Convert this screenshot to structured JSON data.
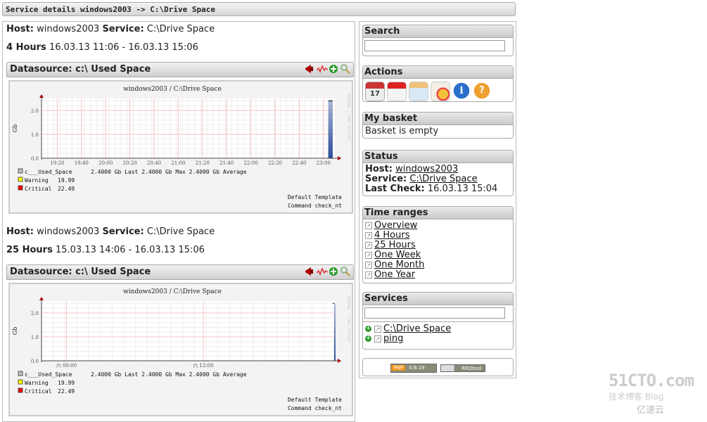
{
  "title": "Service details windows2003 -> C:\\Drive Space",
  "sections": [
    {
      "host_label": "Host:",
      "host": "windows2003",
      "service_label": "Service:",
      "service": "C:\\Drive Space",
      "range_label": "4 Hours",
      "range_value": "16.03.13 11:06 - 16.03.13 15:06",
      "datasource": "Datasource: c:\\ Used Space",
      "icons": [
        "megaphone-icon",
        "graph-line-icon",
        "add-basket-icon",
        "zoom-icon"
      ]
    },
    {
      "host_label": "Host:",
      "host": "windows2003",
      "service_label": "Service:",
      "service": "C:\\Drive Space",
      "range_label": "25 Hours",
      "range_value": "15.03.13 14:06 - 16.03.13 15:06",
      "datasource": "Datasource: c:\\ Used Space",
      "icons": [
        "megaphone-icon",
        "graph-line-icon",
        "add-basket-icon",
        "zoom-icon"
      ]
    }
  ],
  "chart_data": [
    {
      "type": "area",
      "title": "windows2003 / C:\\Drive Space",
      "ylabel": "Gb",
      "xlabel": "",
      "ylim": [
        0,
        2.5
      ],
      "yticks": [
        "0.0",
        "1.0",
        "2.0"
      ],
      "x_ticks": [
        "19:20",
        "19:40",
        "20:00",
        "20:20",
        "20:40",
        "21:00",
        "21:20",
        "21:40",
        "22:00",
        "22:20",
        "22:40",
        "23:00"
      ],
      "series": [
        {
          "name": "c___Used_Space",
          "data_start_fraction": 0.975,
          "values": [
            2.4
          ]
        }
      ],
      "legend": [
        {
          "name": "c___Used_Space",
          "color": "#c0c0c0",
          "text": "2.4000  Gb Last   2.4000  Gb Max   2.4000  Gb Average"
        },
        {
          "name": "Warning",
          "color": "#ffff00",
          "text": "19.99"
        },
        {
          "name": "Critical",
          "color": "#ff0000",
          "text": "22.49"
        }
      ],
      "footer": [
        "Default Template",
        "Command check_nt"
      ],
      "watermark": "RRDTOOL / TOBI OETIKER"
    },
    {
      "type": "area",
      "title": "windows2003 / C:\\Drive Space",
      "ylabel": "Gb",
      "xlabel": "",
      "ylim": [
        0,
        2.5
      ],
      "yticks": [
        "0.0",
        "1.0",
        "2.0"
      ],
      "x_ticks": [
        "六 00:00",
        "六 12:00"
      ],
      "series": [
        {
          "name": "c___Used_Space",
          "data_start_fraction": 0.995,
          "values": [
            2.4
          ]
        }
      ],
      "legend": [
        {
          "name": "c___Used_Space",
          "color": "#c0c0c0",
          "text": "2.4000  Gb Last   2.4000  Gb Max   2.4000  Gb Average"
        },
        {
          "name": "Warning",
          "color": "#ffff00",
          "text": "19.99"
        },
        {
          "name": "Critical",
          "color": "#ff0000",
          "text": "22.49"
        }
      ],
      "footer": [
        "Default Template",
        "Command check_nt"
      ],
      "watermark": "RRDTOOL / TOBI OETIKER"
    }
  ],
  "sidebar": {
    "search": {
      "title": "Search",
      "value": "",
      "placeholder": ""
    },
    "actions": {
      "title": "Actions",
      "icons": [
        "calendar-icon",
        "pdf-icon",
        "xml-icon",
        "basket-chart-icon",
        "info-icon",
        "help-icon"
      ],
      "calendar_day": "17"
    },
    "basket": {
      "title": "My basket",
      "text": "Basket is empty"
    },
    "status": {
      "title": "Status",
      "host_label": "Host:",
      "host": "windows2003",
      "service_label": "Service:",
      "service": "C:\\Drive Space",
      "last_check_label": "Last Check:",
      "last_check": "16.03.13 15:04"
    },
    "time_ranges": {
      "title": "Time ranges",
      "items": [
        "Overview",
        "4 Hours",
        "25 Hours",
        "One Week",
        "One Month",
        "One Year"
      ]
    },
    "services": {
      "title": "Services",
      "filter_value": "",
      "items": [
        "C:\\Drive Space",
        "ping"
      ]
    },
    "badges": {
      "pnp": "PNP",
      "pnp_version": "0.6.19",
      "rrd": "RRDtool"
    }
  },
  "watermark": {
    "line1": "51CTO.com",
    "line2": "技术博客  Blog",
    "line3": "亿速云"
  }
}
